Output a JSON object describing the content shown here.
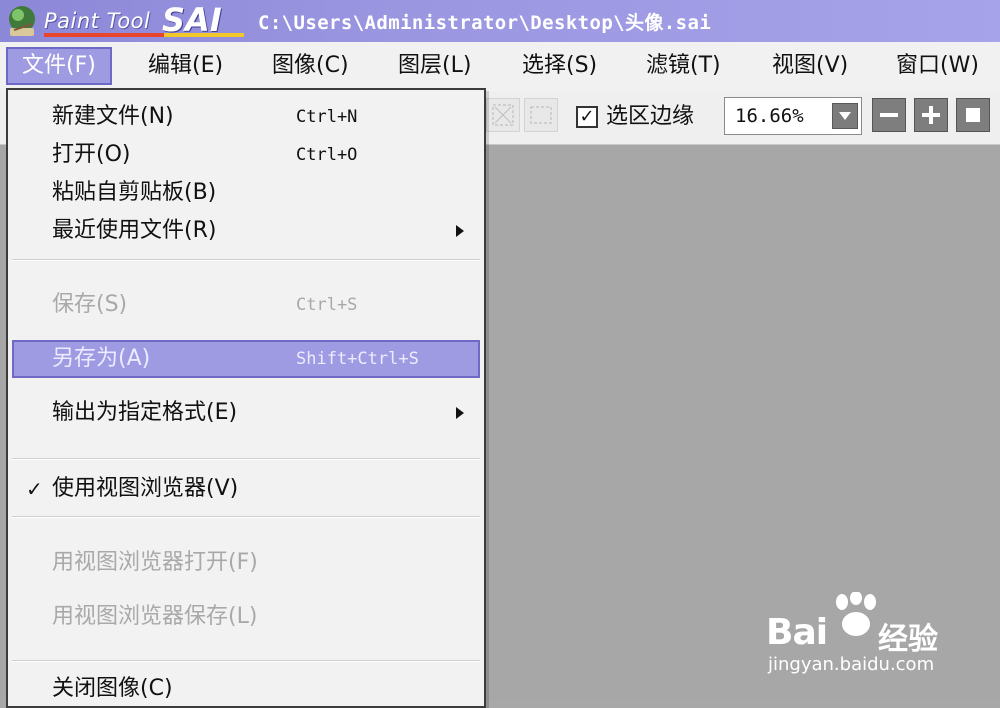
{
  "window": {
    "app_name_small": "Paint Tool",
    "app_name_big": "SAI",
    "file_path": "C:\\Users\\Administrator\\Desktop\\头像.sai"
  },
  "menubar": [
    {
      "label": "文件(F)",
      "active": true
    },
    {
      "label": "编辑(E)",
      "active": false
    },
    {
      "label": "图像(C)",
      "active": false
    },
    {
      "label": "图层(L)",
      "active": false
    },
    {
      "label": "选择(S)",
      "active": false
    },
    {
      "label": "滤镜(T)",
      "active": false
    },
    {
      "label": "视图(V)",
      "active": false
    },
    {
      "label": "窗口(W)",
      "active": false
    }
  ],
  "toolbar": {
    "selection_edge_label": "选区边缘",
    "selection_edge_checked": true,
    "zoom_value": "16.66%",
    "zoom_out_icon": "minus-icon",
    "zoom_in_icon": "plus-icon",
    "reset_icon": "square-icon"
  },
  "file_menu": {
    "items": [
      {
        "label": "新建文件(N)",
        "shortcut": "Ctrl+N",
        "enabled": true,
        "submenu": false,
        "checked": false
      },
      {
        "label": "打开(O)",
        "shortcut": "Ctrl+O",
        "enabled": true,
        "submenu": false,
        "checked": false
      },
      {
        "label": "粘贴自剪贴板(B)",
        "shortcut": "",
        "enabled": true,
        "submenu": false,
        "checked": false
      },
      {
        "label": "最近使用文件(R)",
        "shortcut": "",
        "enabled": true,
        "submenu": true,
        "checked": false
      },
      {
        "label": "保存(S)",
        "shortcut": "Ctrl+S",
        "enabled": false,
        "submenu": false,
        "checked": false
      },
      {
        "label": "另存为(A)",
        "shortcut": "Shift+Ctrl+S",
        "enabled": true,
        "submenu": false,
        "checked": false,
        "highlighted": true
      },
      {
        "label": "输出为指定格式(E)",
        "shortcut": "",
        "enabled": true,
        "submenu": true,
        "checked": false
      },
      {
        "label": "使用视图浏览器(V)",
        "shortcut": "",
        "enabled": true,
        "submenu": false,
        "checked": true
      },
      {
        "label": "用视图浏览器打开(F)",
        "shortcut": "",
        "enabled": false,
        "submenu": false,
        "checked": false
      },
      {
        "label": "用视图浏览器保存(L)",
        "shortcut": "",
        "enabled": false,
        "submenu": false,
        "checked": false
      },
      {
        "label": "关闭图像(C)",
        "shortcut": "",
        "enabled": true,
        "submenu": false,
        "checked": false
      }
    ]
  },
  "watermark": {
    "brand": "Bai",
    "brand_suffix": "经验",
    "url": "jingyan.baidu.com"
  },
  "colors": {
    "title_bar": "#9a96e0",
    "menu_highlight": "#9f9be3",
    "canvas": "#a7a7a7"
  }
}
